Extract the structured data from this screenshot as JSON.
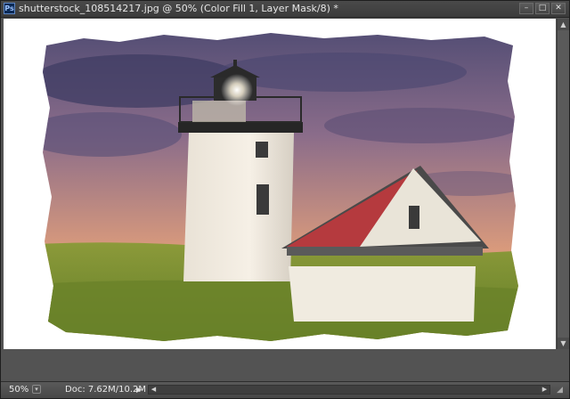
{
  "window": {
    "title": "shutterstock_108514217.jpg @ 50% (Color Fill 1, Layer Mask/8) *",
    "app_icon_label": "Ps",
    "controls": {
      "minimize": "–",
      "maximize": "□",
      "close": "✕"
    }
  },
  "status": {
    "zoom": "50%",
    "doc_size": "Doc: 7.62M/10.2M",
    "menu_arrow": "▶"
  },
  "scrollbars": {
    "left_arrow": "◀",
    "right_arrow": "▶",
    "up_arrow": "▲",
    "down_arrow": "▼"
  },
  "icons": {
    "app": "photoshop-icon",
    "zoom": "zoom-options-icon",
    "grip": "resize-grip-icon"
  },
  "colors": {
    "titlebar": "#3f3f3f",
    "canvas_bg": "#ffffff",
    "sky_top": "#4a4870",
    "sky_bottom": "#e8a070",
    "grass": "#6f8a2e",
    "roof": "#b0303a"
  }
}
